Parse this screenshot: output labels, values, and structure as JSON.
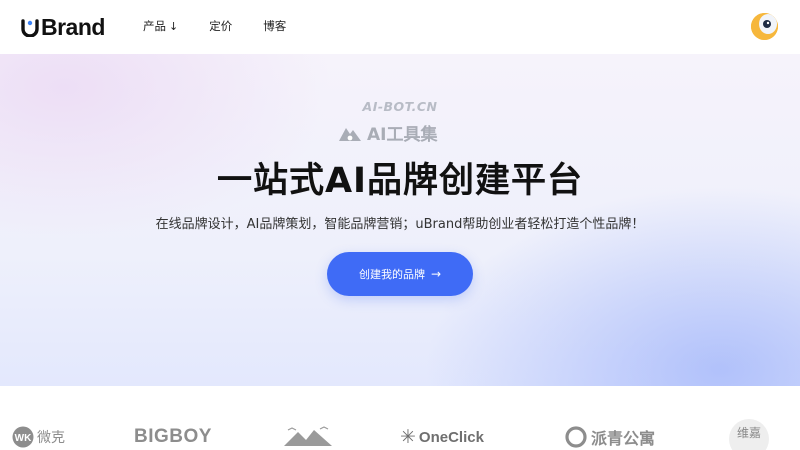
{
  "header": {
    "logo_text": "Brand",
    "nav": [
      {
        "label": "产品",
        "has_dropdown": true
      },
      {
        "label": "定价"
      },
      {
        "label": "博客"
      }
    ]
  },
  "watermark": {
    "line1": "AI-BOT.CN",
    "line2": "AI工具集"
  },
  "hero": {
    "title": "一站式AI品牌创建平台",
    "subtitle": "在线品牌设计，AI品牌策划，智能品牌营销；uBrand帮助创业者轻松打造个性品牌！",
    "cta_label": "创建我的品牌",
    "cta_arrow": "→"
  },
  "brands": [
    {
      "name": "微克",
      "mark": "WK"
    },
    {
      "name": "BIGBOY"
    },
    {
      "name": ""
    },
    {
      "name": "OneClick"
    },
    {
      "name": "派青公寓"
    },
    {
      "name": "维嘉"
    }
  ],
  "colors": {
    "accent": "#3f6bf6",
    "avatar": "#f6b73c",
    "logo_u": "#3b82f6"
  },
  "icons": {
    "nav_dropdown": "arrow-down-icon",
    "cta": "arrow-right-icon",
    "watermark": "mountain-logo-icon"
  }
}
